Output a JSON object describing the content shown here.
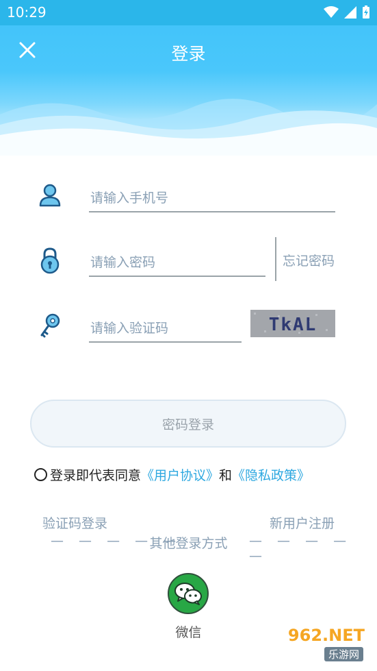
{
  "status": {
    "time": "10:29"
  },
  "header": {
    "title": "登录"
  },
  "form": {
    "phone_placeholder": "请输入手机号",
    "password_placeholder": "请输入密码",
    "forgot_label": "忘记密码",
    "code_placeholder": "请输入验证码",
    "captcha_text": "TkAL"
  },
  "login_button": "密码登录",
  "agreement": {
    "prefix": "登录即代表同意",
    "user_agreement": "《用户协议》",
    "and": "和",
    "privacy_policy": "《隐私政策》"
  },
  "links": {
    "sms_login": "验证码登录",
    "register": "新用户注册"
  },
  "other_login": {
    "title": "其他登录方式",
    "dash_left": "— — — — —",
    "dash_right": "— — — — —",
    "wechat_label": "微信"
  },
  "watermark": {
    "main": "962.NET",
    "sub": "乐游网"
  },
  "colors": {
    "accent": "#2bb6ea",
    "link": "#2ea8e0",
    "wechat": "#28a745"
  }
}
